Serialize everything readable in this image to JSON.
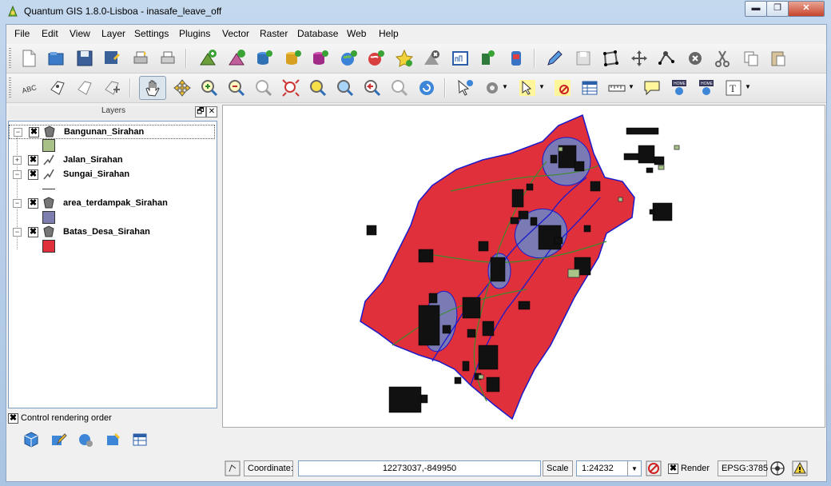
{
  "window": {
    "title": "Quantum GIS 1.8.0-Lisboa - inasafe_leave_off",
    "minimize": "▬",
    "maximize": "❐",
    "close": "✕"
  },
  "menu": [
    "File",
    "Edit",
    "View",
    "Layer",
    "Settings",
    "Plugins",
    "Vector",
    "Raster",
    "Database",
    "Web",
    "Help"
  ],
  "toolbar1": [
    "new-project",
    "open-project",
    "save-project",
    "save-as",
    "new-print-composer",
    "print",
    "add-vector-layer",
    "add-raster-layer",
    "add-postgis-layer",
    "add-spatialite-layer",
    "add-mssql-layer",
    "add-wms-layer",
    "add-wfs-layer",
    "add-delimited-text",
    "remove-layer",
    "new-shapefile",
    "add-gps",
    "inasafe",
    "toggle-editing",
    "save-edits",
    "digitize-polygon",
    "move-feature",
    "node-tool",
    "delete-selected",
    "cut-features",
    "copy-features",
    "paste-features"
  ],
  "toolbar2": [
    "label",
    "pin-labels",
    "show-hide-labels",
    "move-label",
    "pan",
    "pan-to-selected",
    "zoom-in",
    "zoom-out",
    "zoom-full",
    "zoom-to-selection",
    "zoom-to-layer",
    "zoom-native",
    "zoom-last",
    "zoom-next",
    "refresh",
    "identify",
    "action",
    "select",
    "deselect",
    "open-attribute-table",
    "measure",
    "map-tips",
    "new-bookmark",
    "show-bookmarks",
    "text-annotation"
  ],
  "layers_panel": {
    "title": "Layers",
    "float": "🗗",
    "close": "✕",
    "layers": [
      {
        "name": "Bangunan_Sirahan",
        "checked": "✖",
        "expander": "−",
        "swatch": "#a7c186"
      },
      {
        "name": "Jalan_Sirahan",
        "checked": "✖",
        "expander": "+",
        "swatch": ""
      },
      {
        "name": "Sungai_Sirahan",
        "checked": "✖",
        "expander": "−",
        "swatch": "line"
      },
      {
        "name": "area_terdampak_Sirahan",
        "checked": "✖",
        "expander": "−",
        "swatch": "#7d7db0"
      },
      {
        "name": "Batas_Desa_Sirahan",
        "checked": "✖",
        "expander": "−",
        "swatch": "#e0303c"
      }
    ],
    "control_rendering_order": {
      "label": "Control rendering order",
      "checked": "✖"
    }
  },
  "status": {
    "coordinate_label": "Coordinate:",
    "coordinate_value": "12273037,-849950",
    "scale_label": "Scale",
    "scale_value": "1:24232",
    "render_label": "Render",
    "render_checked": "✖",
    "crs": "EPSG:3785"
  },
  "colors": {
    "village": "#e0303c",
    "impact": "#7a7ab5",
    "river": "#1a1acc",
    "road": "#3c8c2c",
    "building_fill": "#a8c488"
  }
}
